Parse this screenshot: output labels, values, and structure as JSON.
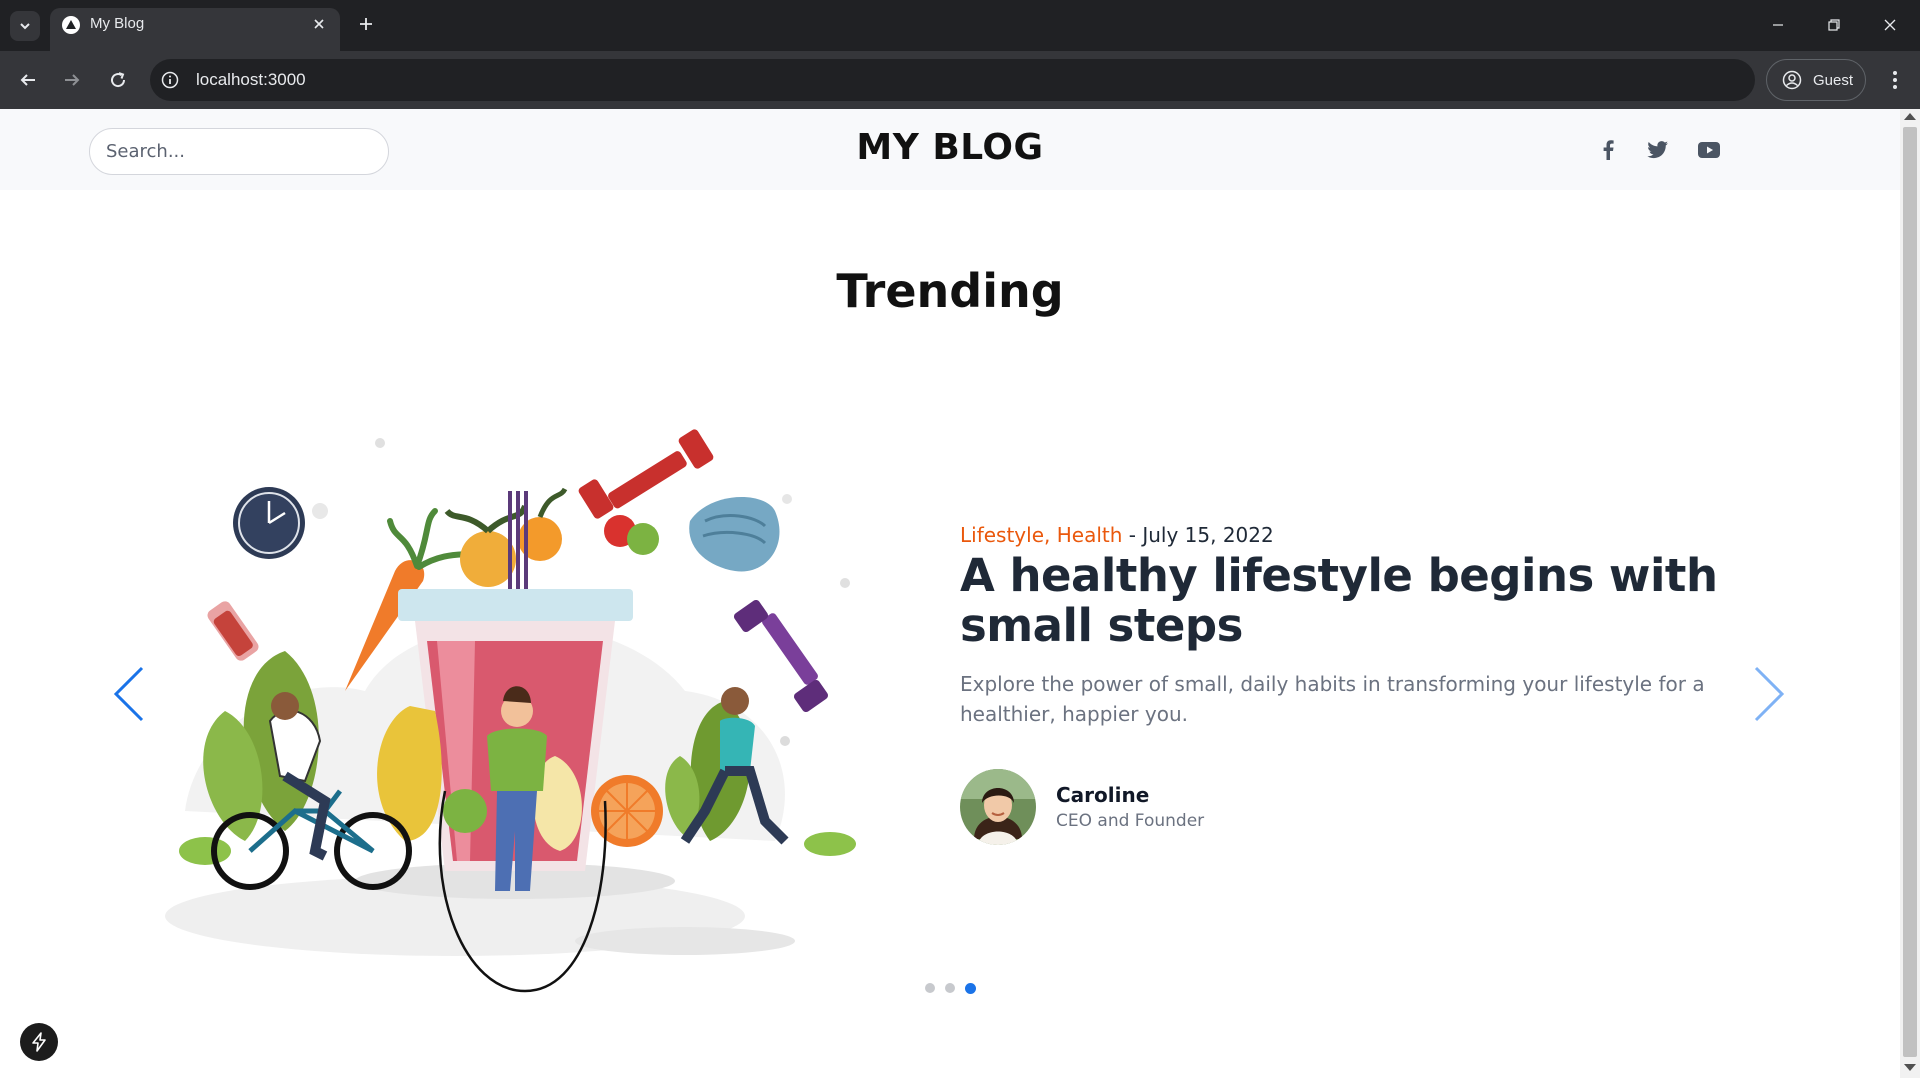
{
  "browser": {
    "tab_title": "My Blog",
    "url": "localhost:3000",
    "profile_label": "Guest"
  },
  "header": {
    "search_placeholder": "Search...",
    "brand": "MY BLOG",
    "social": [
      "facebook-icon",
      "twitter-icon",
      "youtube-icon"
    ]
  },
  "section": {
    "title": "Trending"
  },
  "slide": {
    "categories": "Lifestyle, Health",
    "separator": " - ",
    "date": "July 15, 2022",
    "headline": "A healthy lifestyle begins with small steps",
    "excerpt": "Explore the power of small, daily habits in transforming your lifestyle for a healthier, happier you.",
    "author_name": "Caroline",
    "author_role": "CEO and Founder"
  },
  "carousel": {
    "slide_count": 3,
    "active_index": 2
  },
  "colors": {
    "accent": "#ea580c",
    "arrow": "#1a73e8",
    "text": "#1f2937"
  }
}
